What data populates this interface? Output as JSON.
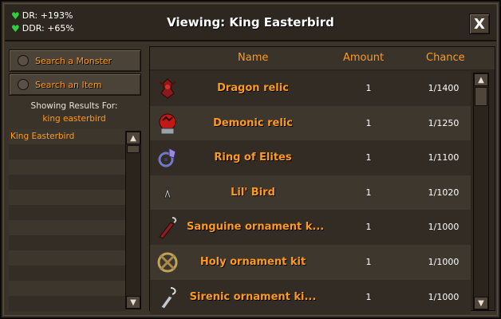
{
  "header": {
    "title": "Viewing: King Easterbird",
    "dr": "DR: +193%",
    "ddr": "DDR: +65%",
    "close_label": "X"
  },
  "search": {
    "monster_label": "Search a Monster",
    "item_label": "Search an Item"
  },
  "results": {
    "showing_label": "Showing Results For:",
    "query": "king easterbird",
    "items": [
      "King Easterbird"
    ]
  },
  "table": {
    "columns": {
      "name": "Name",
      "amount": "Amount",
      "chance": "Chance"
    },
    "rows": [
      {
        "name": "Dragon relic",
        "amount": "1",
        "chance": "1/1400",
        "icon": "dragon-relic-icon"
      },
      {
        "name": "Demonic relic",
        "amount": "1",
        "chance": "1/1250",
        "icon": "demonic-relic-icon"
      },
      {
        "name": "Ring of Elites",
        "amount": "1",
        "chance": "1/1100",
        "icon": "ring-icon"
      },
      {
        "name": "Lil' Bird",
        "amount": "1",
        "chance": "1/1020",
        "icon": "bird-pet-icon"
      },
      {
        "name": "Sanguine ornament k...",
        "amount": "1",
        "chance": "1/1000",
        "icon": "sanguine-kit-icon"
      },
      {
        "name": "Holy ornament kit",
        "amount": "1",
        "chance": "1/1000",
        "icon": "holy-kit-icon"
      },
      {
        "name": "Sirenic ornament ki...",
        "amount": "1",
        "chance": "1/1000",
        "icon": "sirenic-kit-icon"
      }
    ]
  },
  "colors": {
    "accent": "#ff9a1f",
    "heart": "#2fd040",
    "panel": "#3a332a"
  }
}
